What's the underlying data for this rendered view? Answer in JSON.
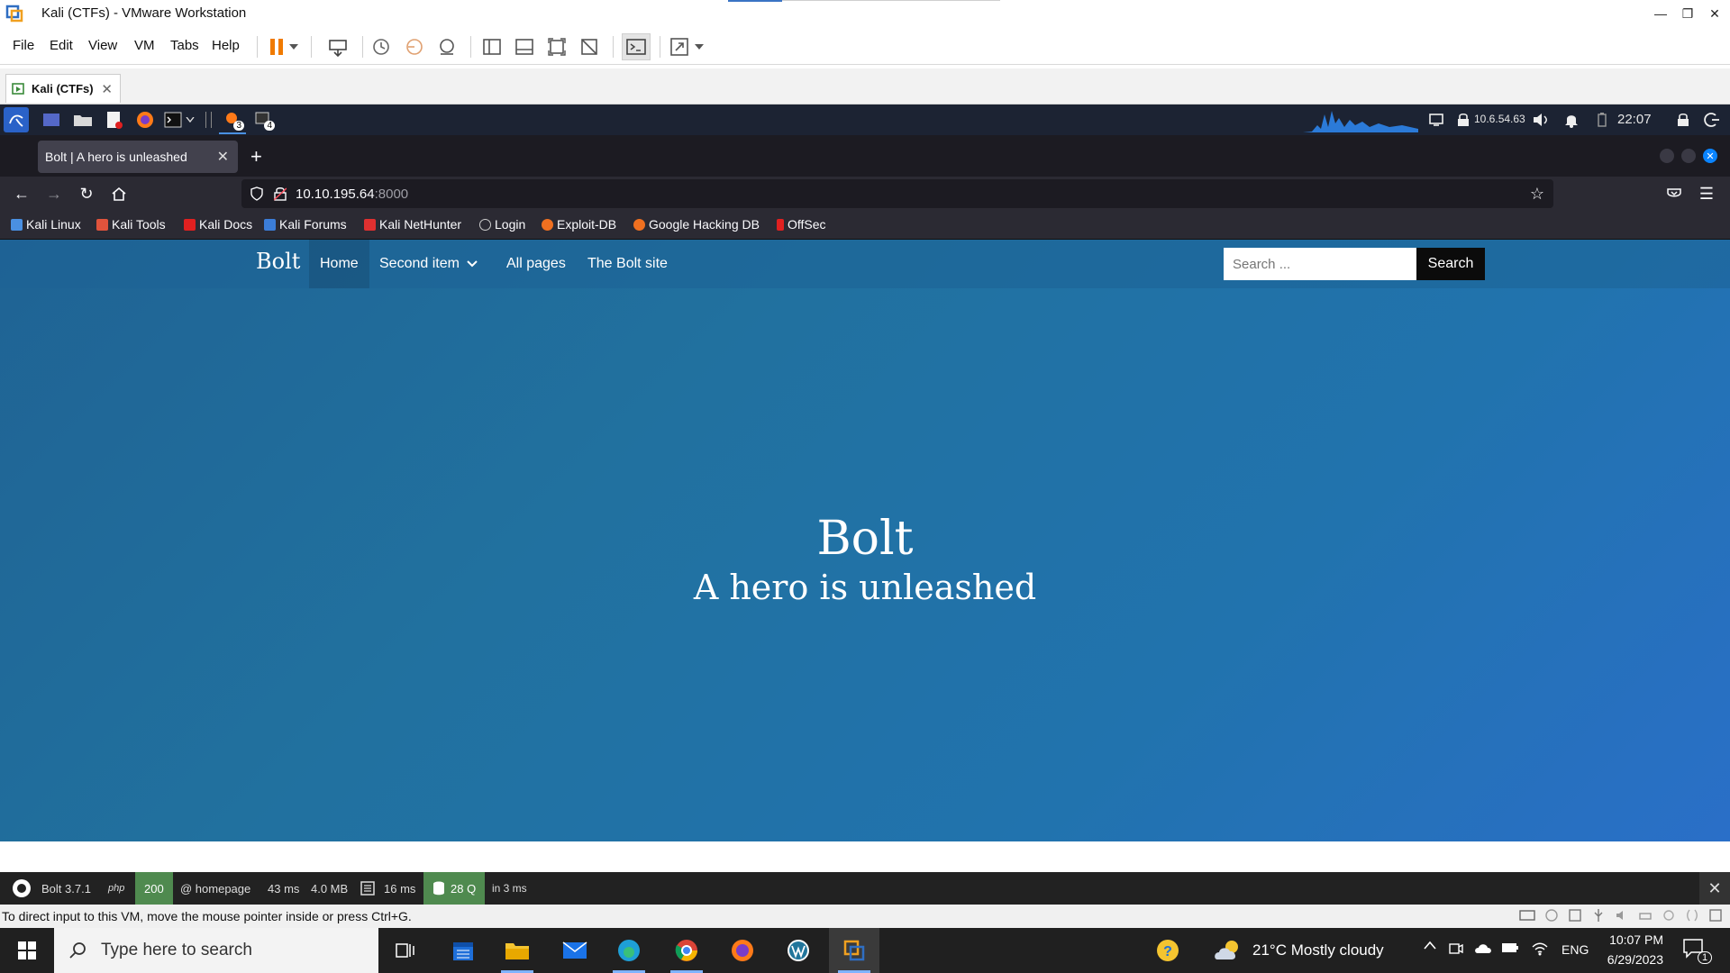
{
  "vmware": {
    "title": "Kali (CTFs) - VMware Workstation",
    "menu": [
      "File",
      "Edit",
      "View",
      "VM",
      "Tabs",
      "Help"
    ],
    "tab_label": "Kali (CTFs)",
    "status_message": "To direct input to this VM, move the mouse pointer inside or press Ctrl+G."
  },
  "kali_panel": {
    "workspace_badge_1": "3",
    "workspace_badge_2": "4",
    "ip": "10.6.54.63",
    "clock": "22:07"
  },
  "browser": {
    "tab_title": "Bolt | A hero is unleashed",
    "url_host": "10.10.195.64",
    "url_port": ":8000",
    "bookmarks": [
      {
        "label": "Kali Linux",
        "color": "#4a90e2"
      },
      {
        "label": "Kali Tools",
        "color": "#e0533c"
      },
      {
        "label": "Kali Docs",
        "color": "#e02020"
      },
      {
        "label": "Kali Forums",
        "color": "#3b7dd8"
      },
      {
        "label": "Kali NetHunter",
        "color": "#e03030"
      },
      {
        "label": "Login",
        "color": "#cccccc"
      },
      {
        "label": "Exploit-DB",
        "color": "#f07020"
      },
      {
        "label": "Google Hacking DB",
        "color": "#f07020"
      },
      {
        "label": "OffSec",
        "color": "#e02020"
      }
    ]
  },
  "site": {
    "brand": "Bolt",
    "nav": [
      "Home",
      "Second item",
      "All pages",
      "The Bolt site"
    ],
    "search_placeholder": "Search ...",
    "search_button": "Search",
    "hero_title": "Bolt",
    "hero_subtitle": "A hero is unleashed"
  },
  "debugbar": {
    "version": "Bolt 3.7.1",
    "php": "php",
    "status": "200",
    "route": "@ homepage",
    "time": "43 ms",
    "memory": "4.0 MB",
    "render_time": "16 ms",
    "queries": "28 Q",
    "query_time": "in 3 ms"
  },
  "taskbar": {
    "search_placeholder": "Type here to search",
    "weather": "21°C  Mostly cloudy",
    "language": "ENG",
    "time": "10:07 PM",
    "date": "6/29/2023",
    "notifications": "1"
  }
}
